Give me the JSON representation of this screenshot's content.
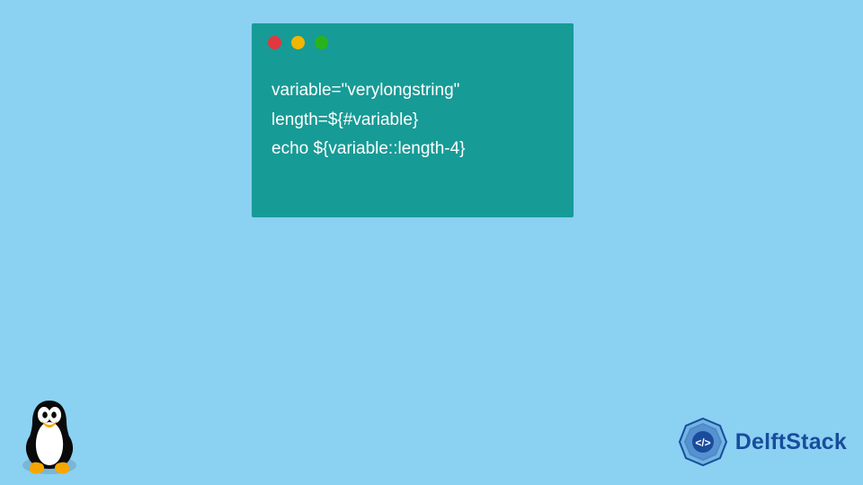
{
  "terminal": {
    "dots": [
      "red",
      "yellow",
      "green"
    ],
    "code": "variable=\"verylongstring\"\nlength=${#variable}\necho ${variable::length-4}"
  },
  "brand": {
    "name": "DelftStack"
  },
  "mascot": {
    "name": "tux-linux-penguin"
  },
  "colors": {
    "background": "#8ad1f2",
    "terminal": "#179b96",
    "brand": "#1a4c9c"
  }
}
